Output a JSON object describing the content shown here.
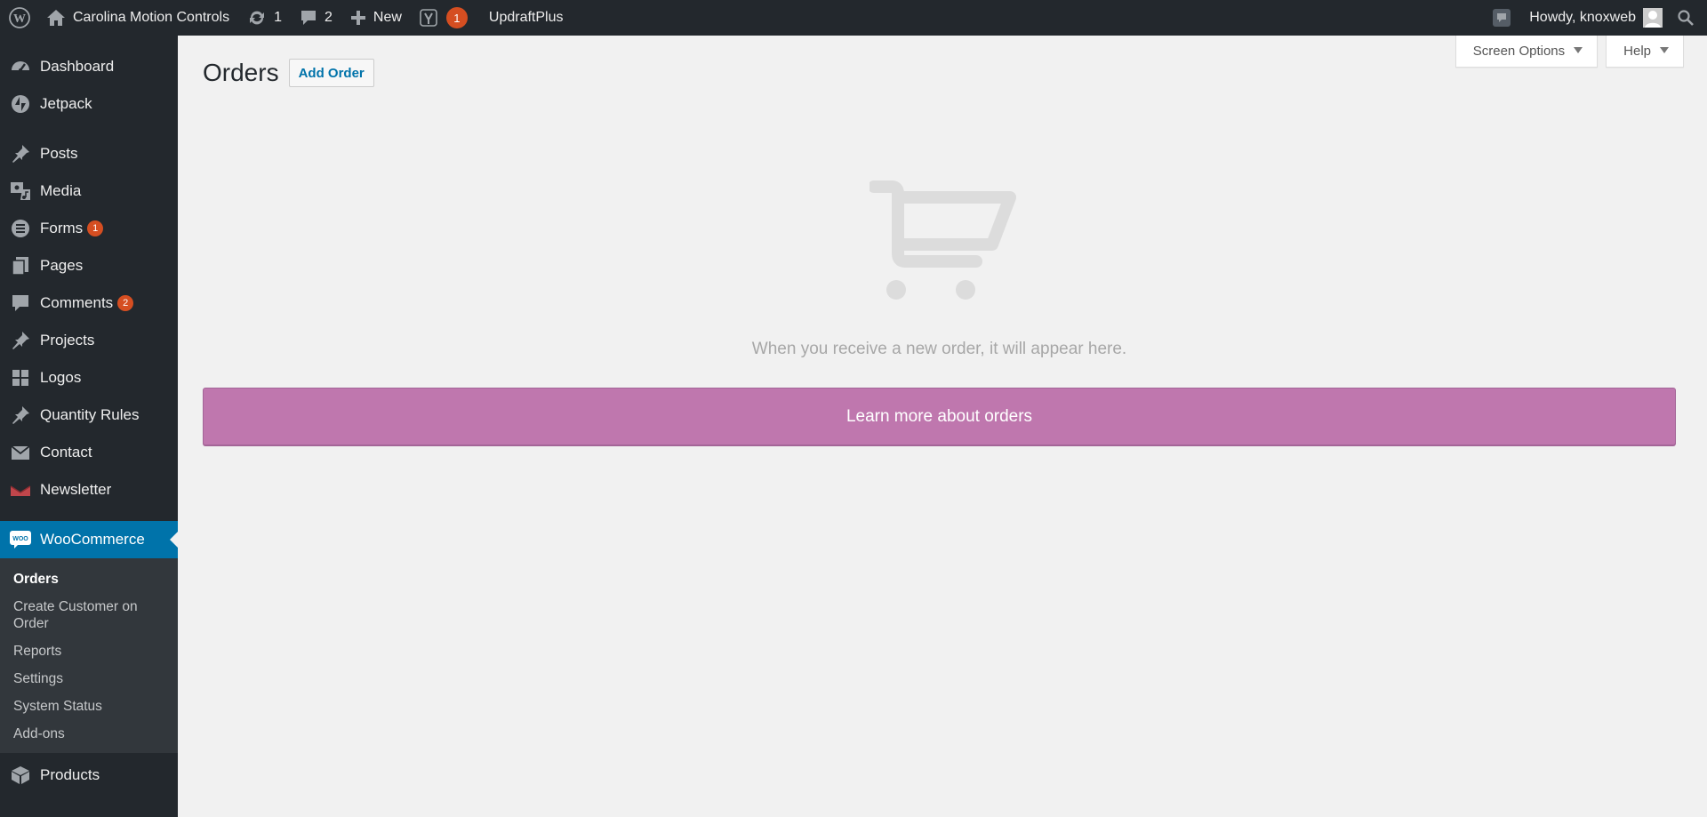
{
  "adminbar": {
    "site_name": "Carolina Motion Controls",
    "updates_count": "1",
    "comments_count": "2",
    "new_label": "New",
    "yoast_badge": "1",
    "updraft_label": "UpdraftPlus",
    "howdy_text": "Howdy, knoxweb"
  },
  "sidebar": {
    "items": [
      {
        "label": "Dashboard",
        "icon": "dashboard-icon"
      },
      {
        "label": "Jetpack",
        "icon": "jetpack-icon"
      },
      {
        "label": "Posts",
        "icon": "pin-icon"
      },
      {
        "label": "Media",
        "icon": "media-icon"
      },
      {
        "label": "Forms",
        "icon": "forms-icon",
        "badge": "1"
      },
      {
        "label": "Pages",
        "icon": "pages-icon"
      },
      {
        "label": "Comments",
        "icon": "comment-icon",
        "badge": "2"
      },
      {
        "label": "Projects",
        "icon": "pin-icon"
      },
      {
        "label": "Logos",
        "icon": "grid-icon"
      },
      {
        "label": "Quantity Rules",
        "icon": "pin-icon"
      },
      {
        "label": "Contact",
        "icon": "envelope-icon"
      },
      {
        "label": "Newsletter",
        "icon": "newsletter-icon"
      }
    ],
    "active": {
      "label": "WooCommerce",
      "icon": "woocommerce-icon"
    },
    "submenu": [
      "Orders",
      "Create Customer on Order",
      "Reports",
      "Settings",
      "System Status",
      "Add-ons"
    ],
    "after": {
      "label": "Products",
      "icon": "box-icon"
    }
  },
  "main": {
    "screen_options_label": "Screen Options",
    "help_label": "Help",
    "title": "Orders",
    "add_order_label": "Add Order",
    "empty_message": "When you receive a new order, it will appear here.",
    "learn_more_label": "Learn more about orders"
  },
  "colors": {
    "adminbar": "#23282d",
    "active_menu": "#0073aa",
    "badge": "#d54e21",
    "learn_more": "#bf77ae"
  }
}
